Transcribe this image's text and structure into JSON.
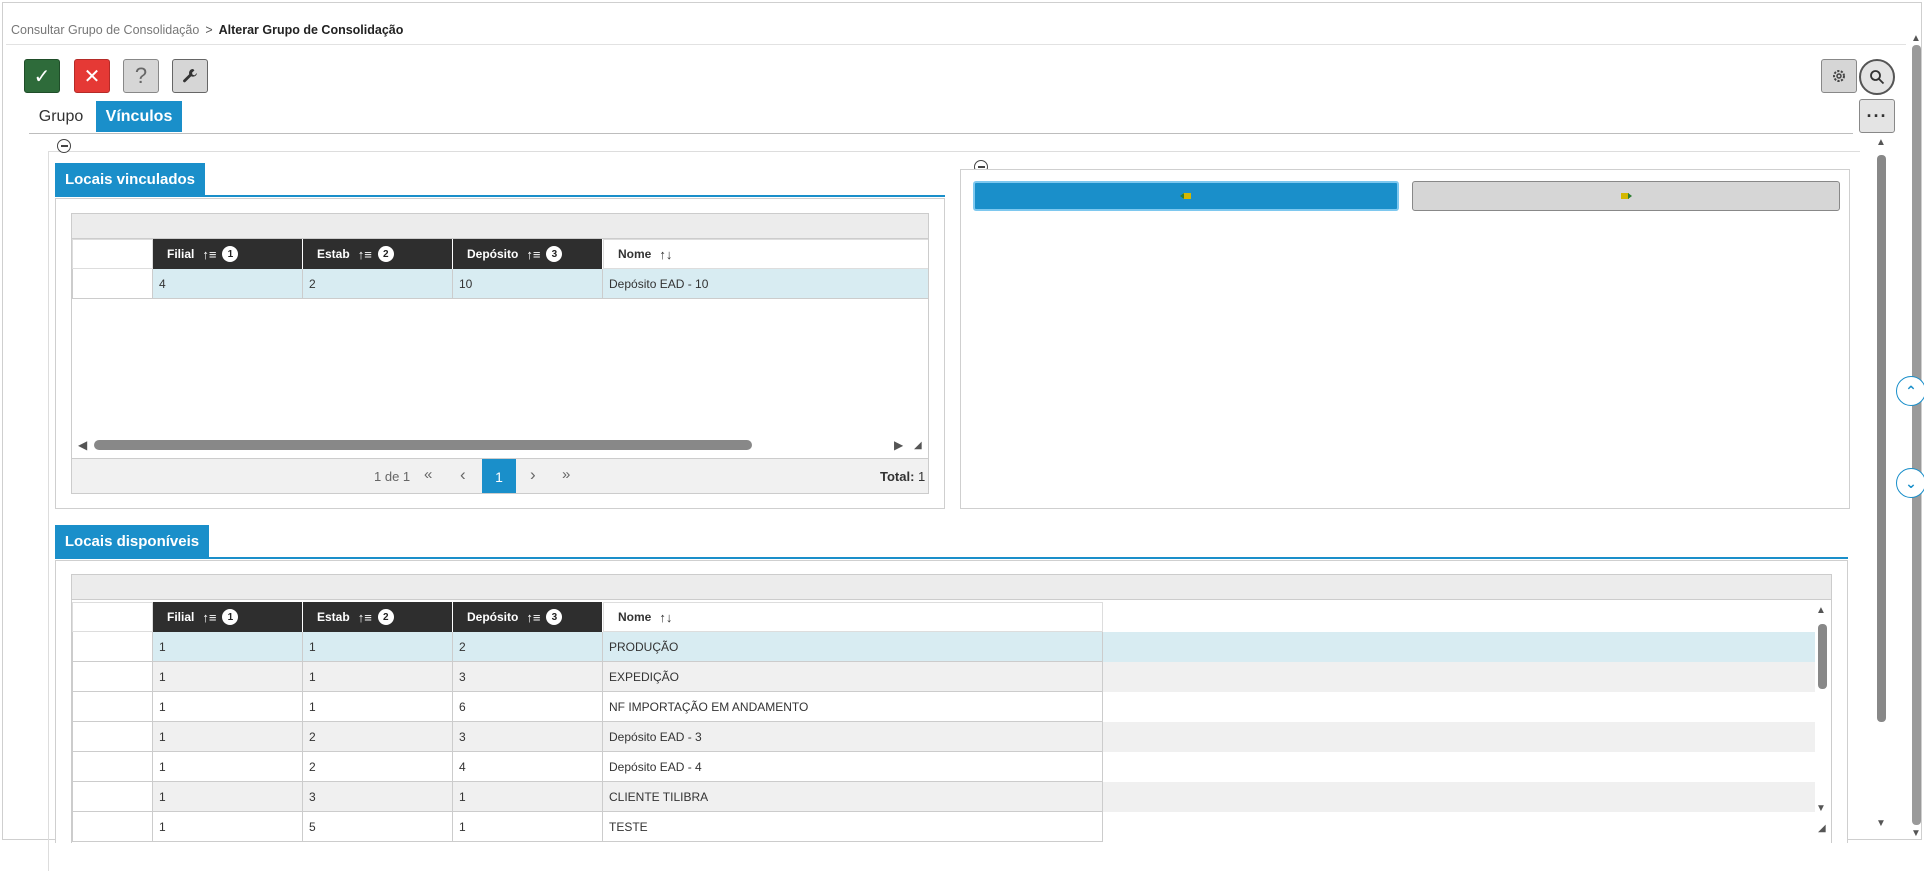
{
  "breadcrumb": {
    "parent": "Consultar Grupo de Consolidação",
    "separator": ">",
    "current": "Alterar Grupo de Consolidação"
  },
  "toolbar": {
    "confirm": "✓",
    "cancel": "✕",
    "help": "?",
    "tools_icon": "wrench-icon",
    "settings_icon": "gear-icon",
    "search_icon": "search-icon",
    "more": "···"
  },
  "tabs": [
    {
      "label": "Grupo",
      "active": false
    },
    {
      "label": "Vínculos",
      "active": true
    }
  ],
  "linked": {
    "title": "Locais vinculados",
    "columns": [
      {
        "label": "Filial",
        "sort": "1"
      },
      {
        "label": "Estab",
        "sort": "2"
      },
      {
        "label": "Depósito",
        "sort": "3"
      },
      {
        "label": "Nome",
        "sort": ""
      }
    ],
    "rows": [
      [
        "4",
        "2",
        "10",
        "Depósito EAD - 10"
      ]
    ],
    "pager": {
      "info": "1 de 1",
      "first": "«",
      "prev": "‹",
      "page": "1",
      "next": "›",
      "last": "»",
      "total_label": "Total:",
      "total": "1"
    }
  },
  "actions": {
    "add_icon": "link-add-icon",
    "remove_icon": "link-remove-icon"
  },
  "available": {
    "title": "Locais disponíveis",
    "columns": [
      {
        "label": "Filial",
        "sort": "1"
      },
      {
        "label": "Estab",
        "sort": "2"
      },
      {
        "label": "Depósito",
        "sort": "3"
      },
      {
        "label": "Nome",
        "sort": ""
      }
    ],
    "rows": [
      [
        "1",
        "1",
        "2",
        "PRODUÇÃO"
      ],
      [
        "1",
        "1",
        "3",
        "EXPEDIÇÃO"
      ],
      [
        "1",
        "1",
        "6",
        "NF IMPORTAÇÃO EM ANDAMENTO"
      ],
      [
        "1",
        "2",
        "3",
        "Depósito EAD - 3"
      ],
      [
        "1",
        "2",
        "4",
        "Depósito EAD - 4"
      ],
      [
        "1",
        "3",
        "1",
        "CLIENTE TILIBRA"
      ],
      [
        "1",
        "5",
        "1",
        "TESTE"
      ]
    ]
  },
  "colors": {
    "accent": "#1a8fca",
    "header_dark": "#2e2e2e",
    "row_highlight": "#d8ecf2",
    "row_alt": "#f0f0f0",
    "confirm": "#2e6b3a",
    "cancel": "#e53935"
  }
}
